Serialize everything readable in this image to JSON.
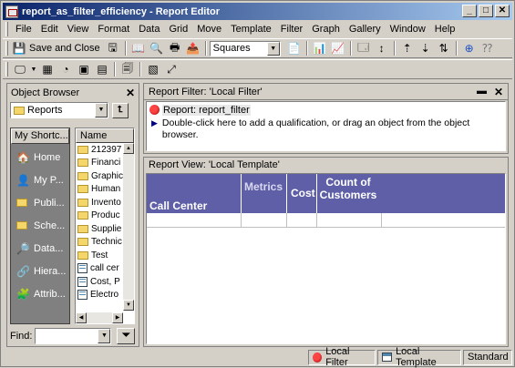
{
  "window": {
    "title": "report_as_filter_efficiency - Report Editor",
    "min": "_",
    "max": "□",
    "close": "✕"
  },
  "menu": [
    "File",
    "Edit",
    "View",
    "Format",
    "Data",
    "Grid",
    "Move",
    "Template",
    "Filter",
    "Graph",
    "Gallery",
    "Window",
    "Help"
  ],
  "toolbar": {
    "save_close_label": "Save and Close",
    "graph_style_value": "Squares"
  },
  "object_browser": {
    "title": "Object Browser",
    "folder_combo_value": "Reports",
    "shortcuts_header": "My Shortc...",
    "shortcuts": [
      {
        "label": "Home",
        "icon": "home-icon"
      },
      {
        "label": "My P...",
        "icon": "personal-objects-icon"
      },
      {
        "label": "Publi...",
        "icon": "public-objects-icon"
      },
      {
        "label": "Sche...",
        "icon": "schema-objects-icon"
      },
      {
        "label": "Data...",
        "icon": "data-explorer-icon"
      },
      {
        "label": "Hiera...",
        "icon": "hierarchies-icon"
      },
      {
        "label": "Attrib...",
        "icon": "attributes-icon"
      }
    ],
    "list_header": "Name",
    "items": [
      {
        "label": "212397",
        "type": "folder"
      },
      {
        "label": "Financi",
        "type": "folder"
      },
      {
        "label": "Graphic",
        "type": "folder"
      },
      {
        "label": "Human",
        "type": "folder"
      },
      {
        "label": "Invento",
        "type": "folder"
      },
      {
        "label": "Produc",
        "type": "folder"
      },
      {
        "label": "Supplie",
        "type": "folder"
      },
      {
        "label": "Technic",
        "type": "folder"
      },
      {
        "label": "Test",
        "type": "folder"
      },
      {
        "label": "call cer",
        "type": "file"
      },
      {
        "label": "Cost, P",
        "type": "file"
      },
      {
        "label": "Electro",
        "type": "file"
      }
    ],
    "find_label": "Find:"
  },
  "report_filter": {
    "title": "Report Filter: 'Local Filter'",
    "report_line": "Report: report_filter",
    "hint": "Double-click here to add a qualification, or drag an object from the object browser."
  },
  "report_view": {
    "title": "Report View: 'Local Template'",
    "headers": {
      "call_center": "Call Center",
      "metrics": "Metrics",
      "cost": "Cost",
      "count": "Count of Customers"
    }
  },
  "status": {
    "local_filter": "Local Filter",
    "local_template": "Local Template",
    "mode": "Standard"
  }
}
